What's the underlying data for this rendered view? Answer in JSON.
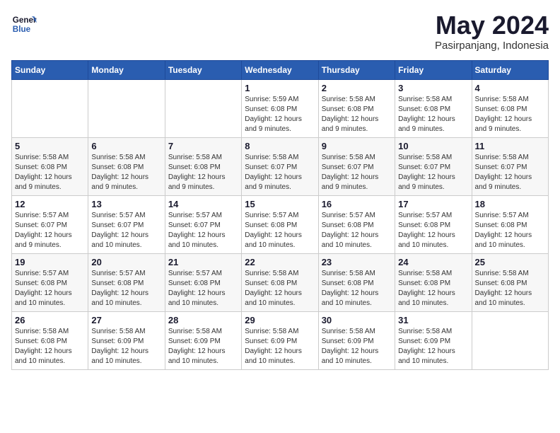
{
  "header": {
    "logo_line1": "General",
    "logo_line2": "Blue",
    "month": "May 2024",
    "location": "Pasirpanjang, Indonesia"
  },
  "weekdays": [
    "Sunday",
    "Monday",
    "Tuesday",
    "Wednesday",
    "Thursday",
    "Friday",
    "Saturday"
  ],
  "weeks": [
    [
      {
        "day": "",
        "info": ""
      },
      {
        "day": "",
        "info": ""
      },
      {
        "day": "",
        "info": ""
      },
      {
        "day": "1",
        "info": "Sunrise: 5:59 AM\nSunset: 6:08 PM\nDaylight: 12 hours\nand 9 minutes."
      },
      {
        "day": "2",
        "info": "Sunrise: 5:58 AM\nSunset: 6:08 PM\nDaylight: 12 hours\nand 9 minutes."
      },
      {
        "day": "3",
        "info": "Sunrise: 5:58 AM\nSunset: 6:08 PM\nDaylight: 12 hours\nand 9 minutes."
      },
      {
        "day": "4",
        "info": "Sunrise: 5:58 AM\nSunset: 6:08 PM\nDaylight: 12 hours\nand 9 minutes."
      }
    ],
    [
      {
        "day": "5",
        "info": "Sunrise: 5:58 AM\nSunset: 6:08 PM\nDaylight: 12 hours\nand 9 minutes."
      },
      {
        "day": "6",
        "info": "Sunrise: 5:58 AM\nSunset: 6:08 PM\nDaylight: 12 hours\nand 9 minutes."
      },
      {
        "day": "7",
        "info": "Sunrise: 5:58 AM\nSunset: 6:08 PM\nDaylight: 12 hours\nand 9 minutes."
      },
      {
        "day": "8",
        "info": "Sunrise: 5:58 AM\nSunset: 6:07 PM\nDaylight: 12 hours\nand 9 minutes."
      },
      {
        "day": "9",
        "info": "Sunrise: 5:58 AM\nSunset: 6:07 PM\nDaylight: 12 hours\nand 9 minutes."
      },
      {
        "day": "10",
        "info": "Sunrise: 5:58 AM\nSunset: 6:07 PM\nDaylight: 12 hours\nand 9 minutes."
      },
      {
        "day": "11",
        "info": "Sunrise: 5:58 AM\nSunset: 6:07 PM\nDaylight: 12 hours\nand 9 minutes."
      }
    ],
    [
      {
        "day": "12",
        "info": "Sunrise: 5:57 AM\nSunset: 6:07 PM\nDaylight: 12 hours\nand 9 minutes."
      },
      {
        "day": "13",
        "info": "Sunrise: 5:57 AM\nSunset: 6:07 PM\nDaylight: 12 hours\nand 10 minutes."
      },
      {
        "day": "14",
        "info": "Sunrise: 5:57 AM\nSunset: 6:07 PM\nDaylight: 12 hours\nand 10 minutes."
      },
      {
        "day": "15",
        "info": "Sunrise: 5:57 AM\nSunset: 6:08 PM\nDaylight: 12 hours\nand 10 minutes."
      },
      {
        "day": "16",
        "info": "Sunrise: 5:57 AM\nSunset: 6:08 PM\nDaylight: 12 hours\nand 10 minutes."
      },
      {
        "day": "17",
        "info": "Sunrise: 5:57 AM\nSunset: 6:08 PM\nDaylight: 12 hours\nand 10 minutes."
      },
      {
        "day": "18",
        "info": "Sunrise: 5:57 AM\nSunset: 6:08 PM\nDaylight: 12 hours\nand 10 minutes."
      }
    ],
    [
      {
        "day": "19",
        "info": "Sunrise: 5:57 AM\nSunset: 6:08 PM\nDaylight: 12 hours\nand 10 minutes."
      },
      {
        "day": "20",
        "info": "Sunrise: 5:57 AM\nSunset: 6:08 PM\nDaylight: 12 hours\nand 10 minutes."
      },
      {
        "day": "21",
        "info": "Sunrise: 5:57 AM\nSunset: 6:08 PM\nDaylight: 12 hours\nand 10 minutes."
      },
      {
        "day": "22",
        "info": "Sunrise: 5:58 AM\nSunset: 6:08 PM\nDaylight: 12 hours\nand 10 minutes."
      },
      {
        "day": "23",
        "info": "Sunrise: 5:58 AM\nSunset: 6:08 PM\nDaylight: 12 hours\nand 10 minutes."
      },
      {
        "day": "24",
        "info": "Sunrise: 5:58 AM\nSunset: 6:08 PM\nDaylight: 12 hours\nand 10 minutes."
      },
      {
        "day": "25",
        "info": "Sunrise: 5:58 AM\nSunset: 6:08 PM\nDaylight: 12 hours\nand 10 minutes."
      }
    ],
    [
      {
        "day": "26",
        "info": "Sunrise: 5:58 AM\nSunset: 6:08 PM\nDaylight: 12 hours\nand 10 minutes."
      },
      {
        "day": "27",
        "info": "Sunrise: 5:58 AM\nSunset: 6:09 PM\nDaylight: 12 hours\nand 10 minutes."
      },
      {
        "day": "28",
        "info": "Sunrise: 5:58 AM\nSunset: 6:09 PM\nDaylight: 12 hours\nand 10 minutes."
      },
      {
        "day": "29",
        "info": "Sunrise: 5:58 AM\nSunset: 6:09 PM\nDaylight: 12 hours\nand 10 minutes."
      },
      {
        "day": "30",
        "info": "Sunrise: 5:58 AM\nSunset: 6:09 PM\nDaylight: 12 hours\nand 10 minutes."
      },
      {
        "day": "31",
        "info": "Sunrise: 5:58 AM\nSunset: 6:09 PM\nDaylight: 12 hours\nand 10 minutes."
      },
      {
        "day": "",
        "info": ""
      }
    ]
  ]
}
